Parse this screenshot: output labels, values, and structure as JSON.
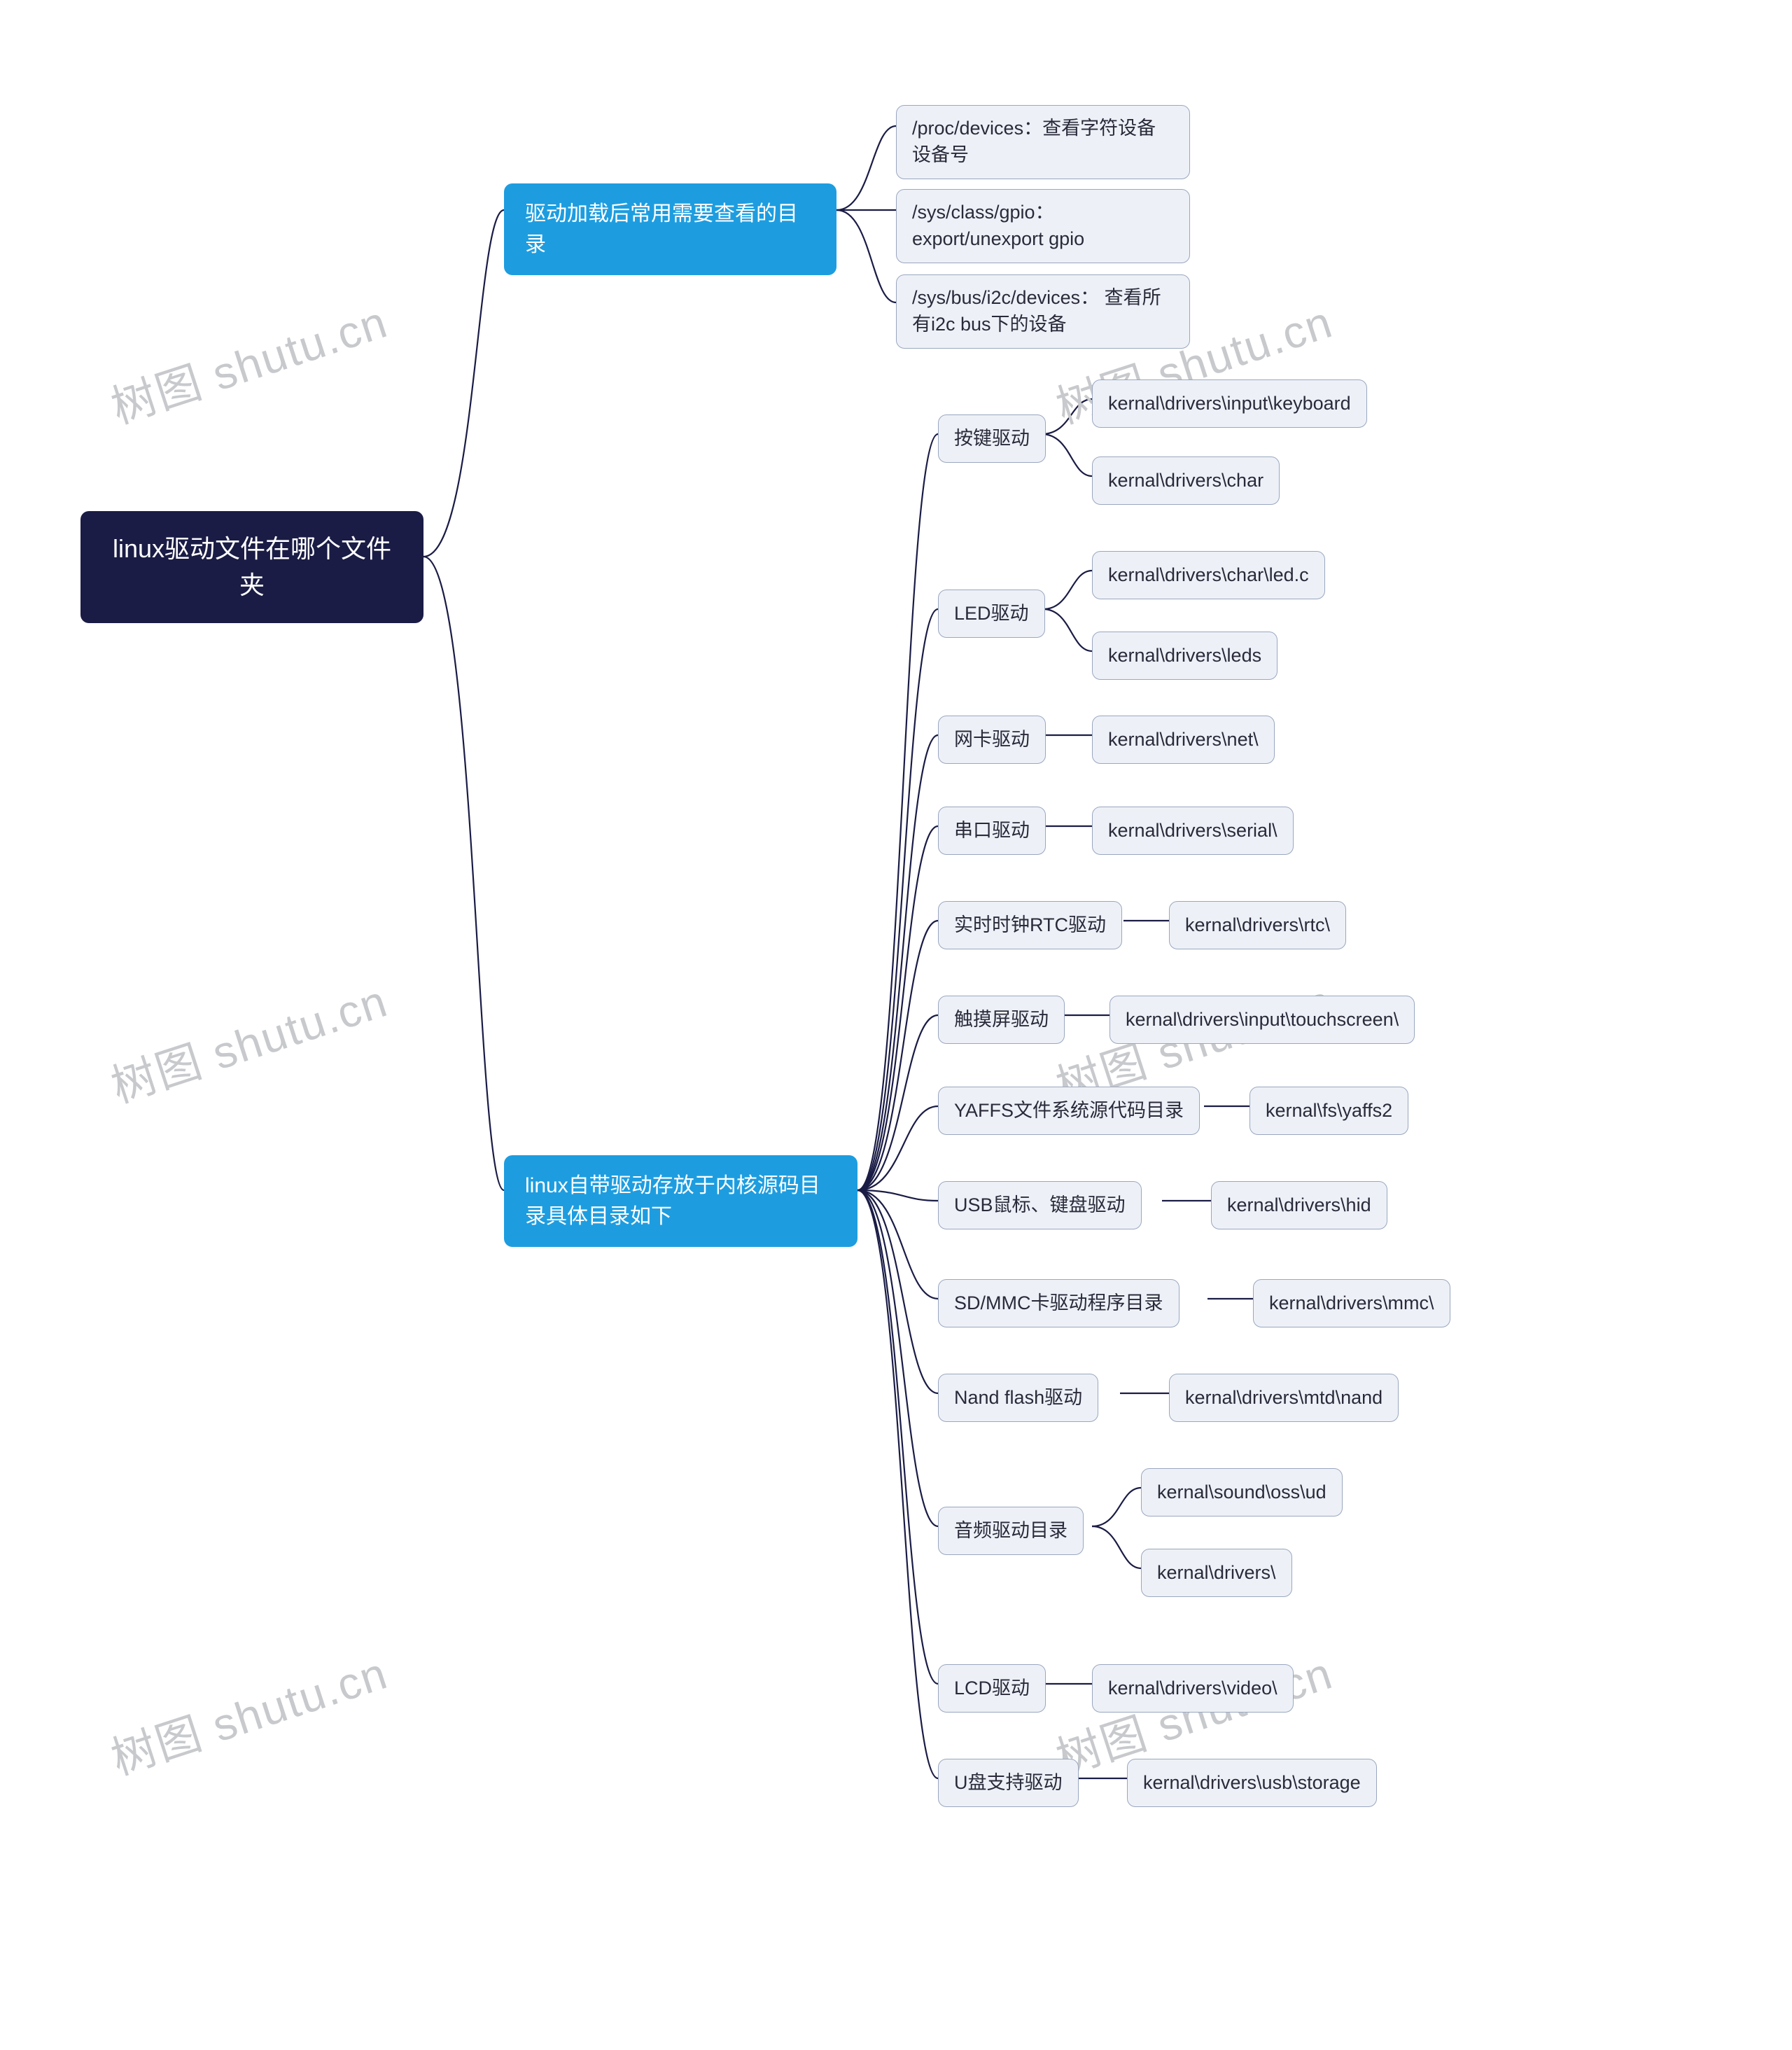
{
  "root": {
    "title": "linux驱动文件在哪个文件夹"
  },
  "topics": {
    "t1": {
      "label": "驱动加载后常用需要查看的目录"
    },
    "t2": {
      "label": "linux自带驱动存放于内核源码目录具体目录如下"
    }
  },
  "t1_children": {
    "c1": "/proc/devices：查看字符设备设备号",
    "c2": "/sys/class/gpio：export/unexport gpio",
    "c3": "/sys/bus/i2c/devices： 查看所有i2c bus下的设备"
  },
  "t2_children": {
    "keypad": {
      "label": "按键驱动",
      "paths": [
        "kernal\\drivers\\input\\keyboard",
        "kernal\\drivers\\char"
      ]
    },
    "led": {
      "label": "LED驱动",
      "paths": [
        "kernal\\drivers\\char\\led.c",
        "kernal\\drivers\\leds"
      ]
    },
    "net": {
      "label": "网卡驱动",
      "paths": [
        "kernal\\drivers\\net\\"
      ]
    },
    "serial": {
      "label": "串口驱动",
      "paths": [
        "kernal\\drivers\\serial\\"
      ]
    },
    "rtc": {
      "label": "实时时钟RTC驱动",
      "paths": [
        "kernal\\drivers\\rtc\\"
      ]
    },
    "touch": {
      "label": "触摸屏驱动",
      "paths": [
        "kernal\\drivers\\input\\touchscreen\\"
      ]
    },
    "yaffs": {
      "label": "YAFFS文件系统源代码目录",
      "paths": [
        "kernal\\fs\\yaffs2"
      ]
    },
    "usbhid": {
      "label": "USB鼠标、键盘驱动",
      "paths": [
        "kernal\\drivers\\hid"
      ]
    },
    "sdmmc": {
      "label": "SD/MMC卡驱动程序目录",
      "paths": [
        "kernal\\drivers\\mmc\\"
      ]
    },
    "nand": {
      "label": "Nand flash驱动",
      "paths": [
        "kernal\\drivers\\mtd\\nand"
      ]
    },
    "audio": {
      "label": "音频驱动目录",
      "paths": [
        "kernal\\sound\\oss\\ud",
        "kernal\\drivers\\"
      ]
    },
    "lcd": {
      "label": "LCD驱动",
      "paths": [
        "kernal\\drivers\\video\\"
      ]
    },
    "usbstorage": {
      "label": "U盘支持驱动",
      "paths": [
        "kernal\\drivers\\usb\\storage"
      ]
    }
  },
  "watermark": "树图 shutu.cn"
}
